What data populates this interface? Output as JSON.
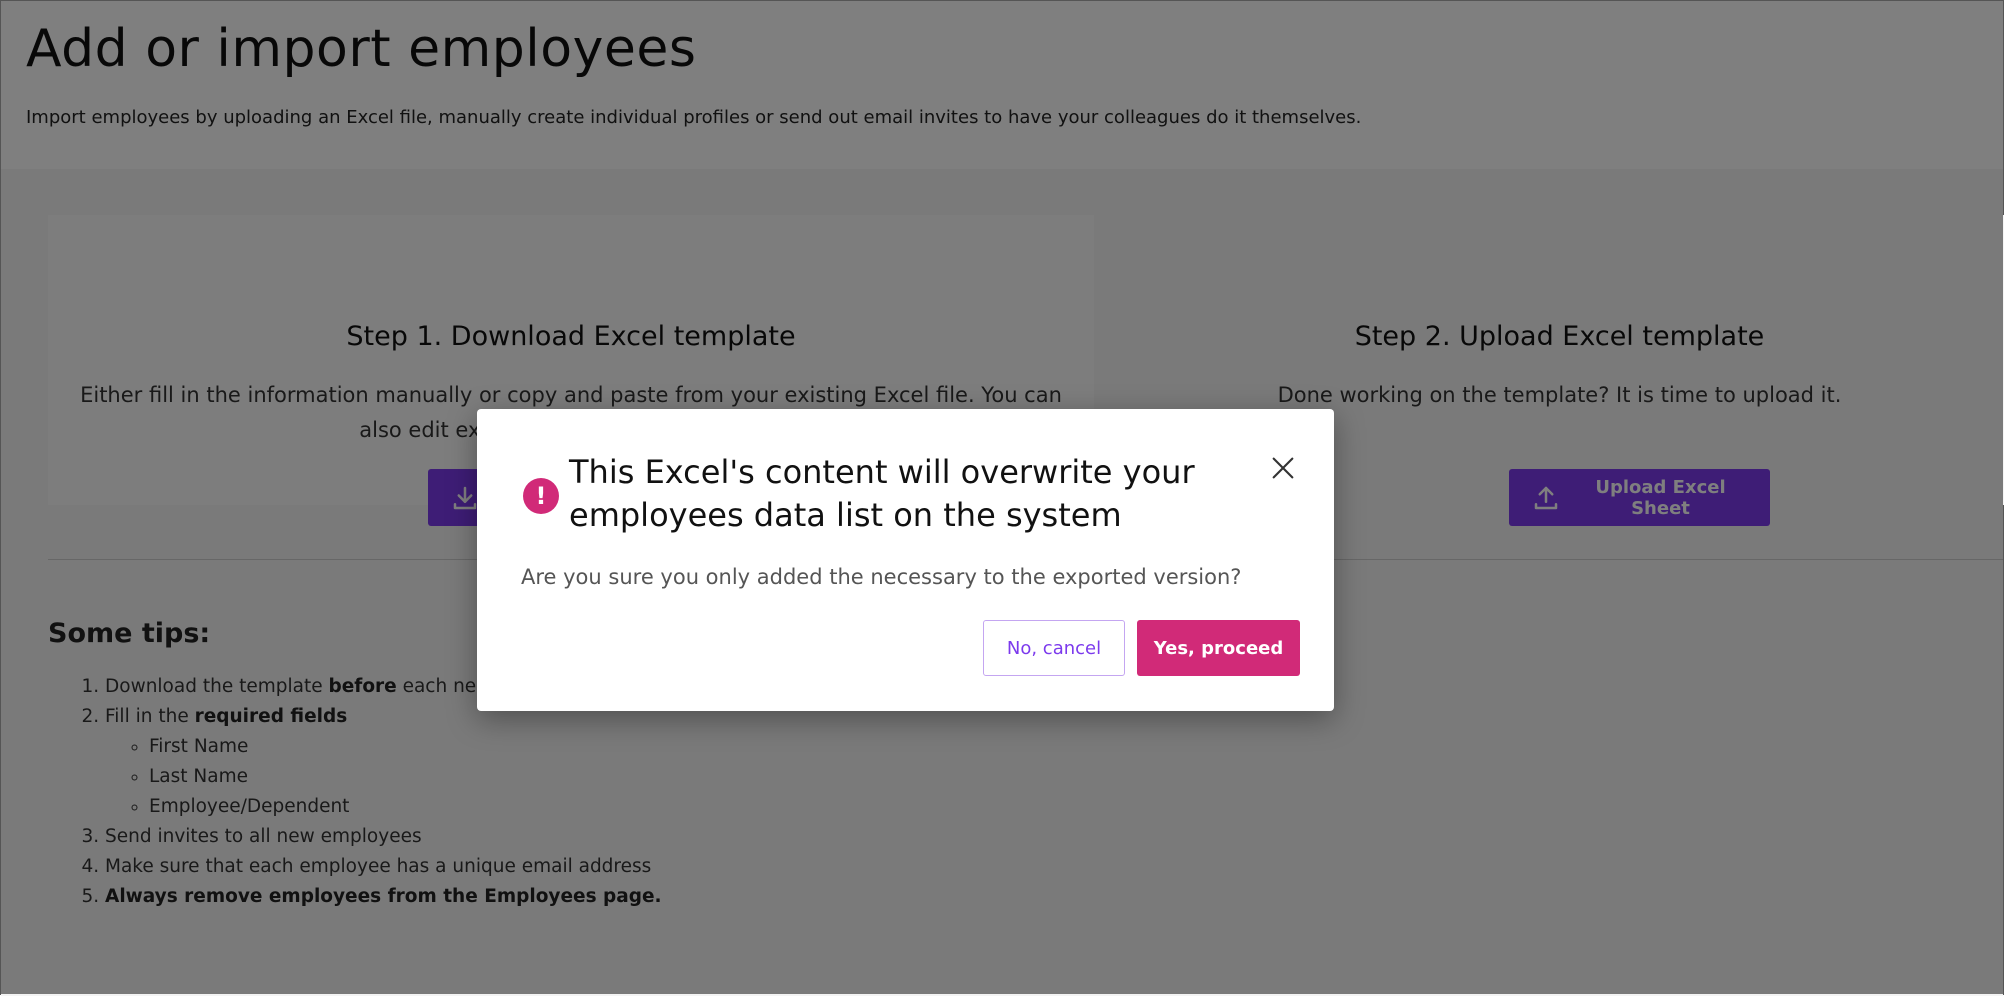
{
  "header": {
    "title": "Add or import employees",
    "subtitle": "Import employees by uploading an Excel file, manually create individual profiles or send out email invites to have your colleagues do it themselves."
  },
  "steps": [
    {
      "title": "Step 1. Download Excel template",
      "description": "Either fill in the information manually or copy and paste from your existing Excel file. You can also edit existing employee information.",
      "button_label": "",
      "icon": "download-icon"
    },
    {
      "title": "Step 2. Upload Excel template",
      "description": "Done working on the template? It is time to upload it.",
      "button_label": "Upload Excel Sheet",
      "icon": "upload-icon"
    }
  ],
  "tips": {
    "title": "Some tips:",
    "items": {
      "t1_a": "Download the template ",
      "t1_b": "before",
      "t1_c": " each new",
      "t2_a": "Fill in the ",
      "t2_b": "required fields",
      "t2_sub": [
        "First Name",
        "Last Name",
        "Employee/Dependent"
      ],
      "t3": "Send invites to all new employees",
      "t4": "Make sure that each employee has a unique email address",
      "t5": "Always remove employees from the Employees page."
    }
  },
  "modal": {
    "icon_symbol": "!",
    "title": "This Excel's content will overwrite your employees data list on the system",
    "question": "Are you sure you only added the necessary to the exported version?",
    "cancel_label": "No, cancel",
    "proceed_label": "Yes, proceed"
  },
  "colors": {
    "primary": "#7c3aed",
    "danger": "#d12a78",
    "overlay": "rgba(0,0,0,0.5)"
  }
}
